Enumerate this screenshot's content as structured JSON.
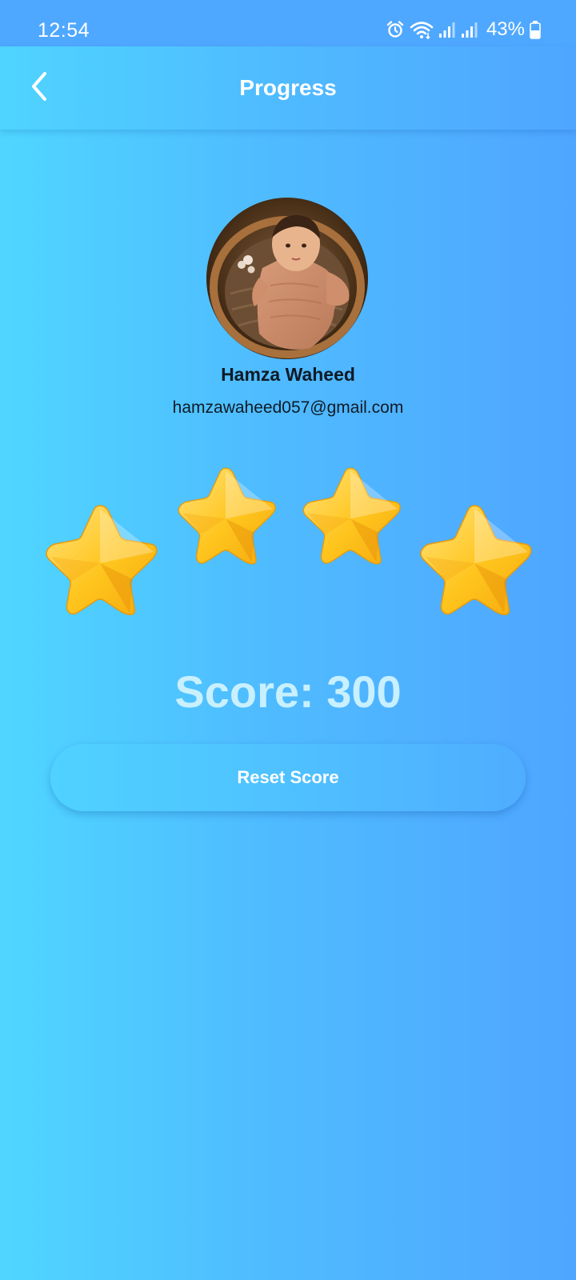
{
  "status_bar": {
    "time": "12:54",
    "battery_percent": "43%",
    "icons": [
      "alarm-icon",
      "wifi-icon",
      "signal-icon",
      "signal-icon",
      "battery-icon"
    ]
  },
  "app_bar": {
    "title": "Progress",
    "back_icon": "chevron-left-icon"
  },
  "profile": {
    "name": "Hamza Waheed",
    "email": "hamzawaheed057@gmail.com"
  },
  "stars": {
    "count": 4,
    "icon": "star-icon",
    "color": "#ffc21c"
  },
  "score": {
    "label": "Score: 300"
  },
  "reset_button": {
    "label": "Reset Score"
  },
  "colors": {
    "gradient_start": "#4fd6ff",
    "gradient_end": "#4fa6ff",
    "score_text": "#c8f0ff",
    "text_dark": "#0f1a26"
  }
}
